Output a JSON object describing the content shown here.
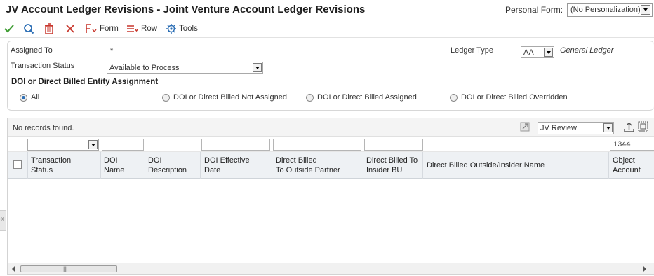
{
  "window": {
    "title": "JV Account Ledger Revisions - Joint Venture Account Ledger Revisions",
    "personal_form_label": "Personal Form:",
    "personal_form_value": "(No Personalization)"
  },
  "toolbar": {
    "ok_icon": "check-icon",
    "find_icon": "search-icon",
    "delete_icon": "trash-icon",
    "cancel_icon": "close-icon",
    "form_label": "Form",
    "row_label": "Row",
    "tools_label": "Tools"
  },
  "header": {
    "assigned_to_label": "Assigned To",
    "assigned_to_value": "*",
    "transaction_status_label": "Transaction Status",
    "transaction_status_value": "Available to Process",
    "ledger_type_label": "Ledger Type",
    "ledger_type_value": "AA",
    "ledger_type_description": "General Ledger",
    "section_title": "DOI or Direct Billed Entity Assignment",
    "radio_options": [
      {
        "label": "All",
        "selected": true
      },
      {
        "label": "DOI or Direct Billed Not Assigned",
        "selected": false
      },
      {
        "label": "DOI or Direct Billed Assigned",
        "selected": false
      },
      {
        "label": "DOI or Direct Billed Overridden",
        "selected": false
      }
    ]
  },
  "grid": {
    "status_text": "No records found.",
    "view_select_value": "JV Review",
    "qbe_object_account": "1344",
    "columns": [
      {
        "line1": "Transaction",
        "line2": "Status"
      },
      {
        "line1": "DOI",
        "line2": "Name"
      },
      {
        "line1": "DOI",
        "line2": "Description"
      },
      {
        "line1": "DOI Effective",
        "line2": "Date"
      },
      {
        "line1": "Direct Billed",
        "line2": "To Outside Partner"
      },
      {
        "line1": "Direct Billed To",
        "line2": "Insider BU"
      },
      {
        "line1": "Direct Billed Outside/Insider Name",
        "line2": ""
      },
      {
        "line1": "Object",
        "line2": "Account"
      }
    ]
  },
  "colors": {
    "accent_green": "#3a9a2e",
    "accent_blue": "#2d6fb5",
    "accent_red": "#c8372d"
  }
}
